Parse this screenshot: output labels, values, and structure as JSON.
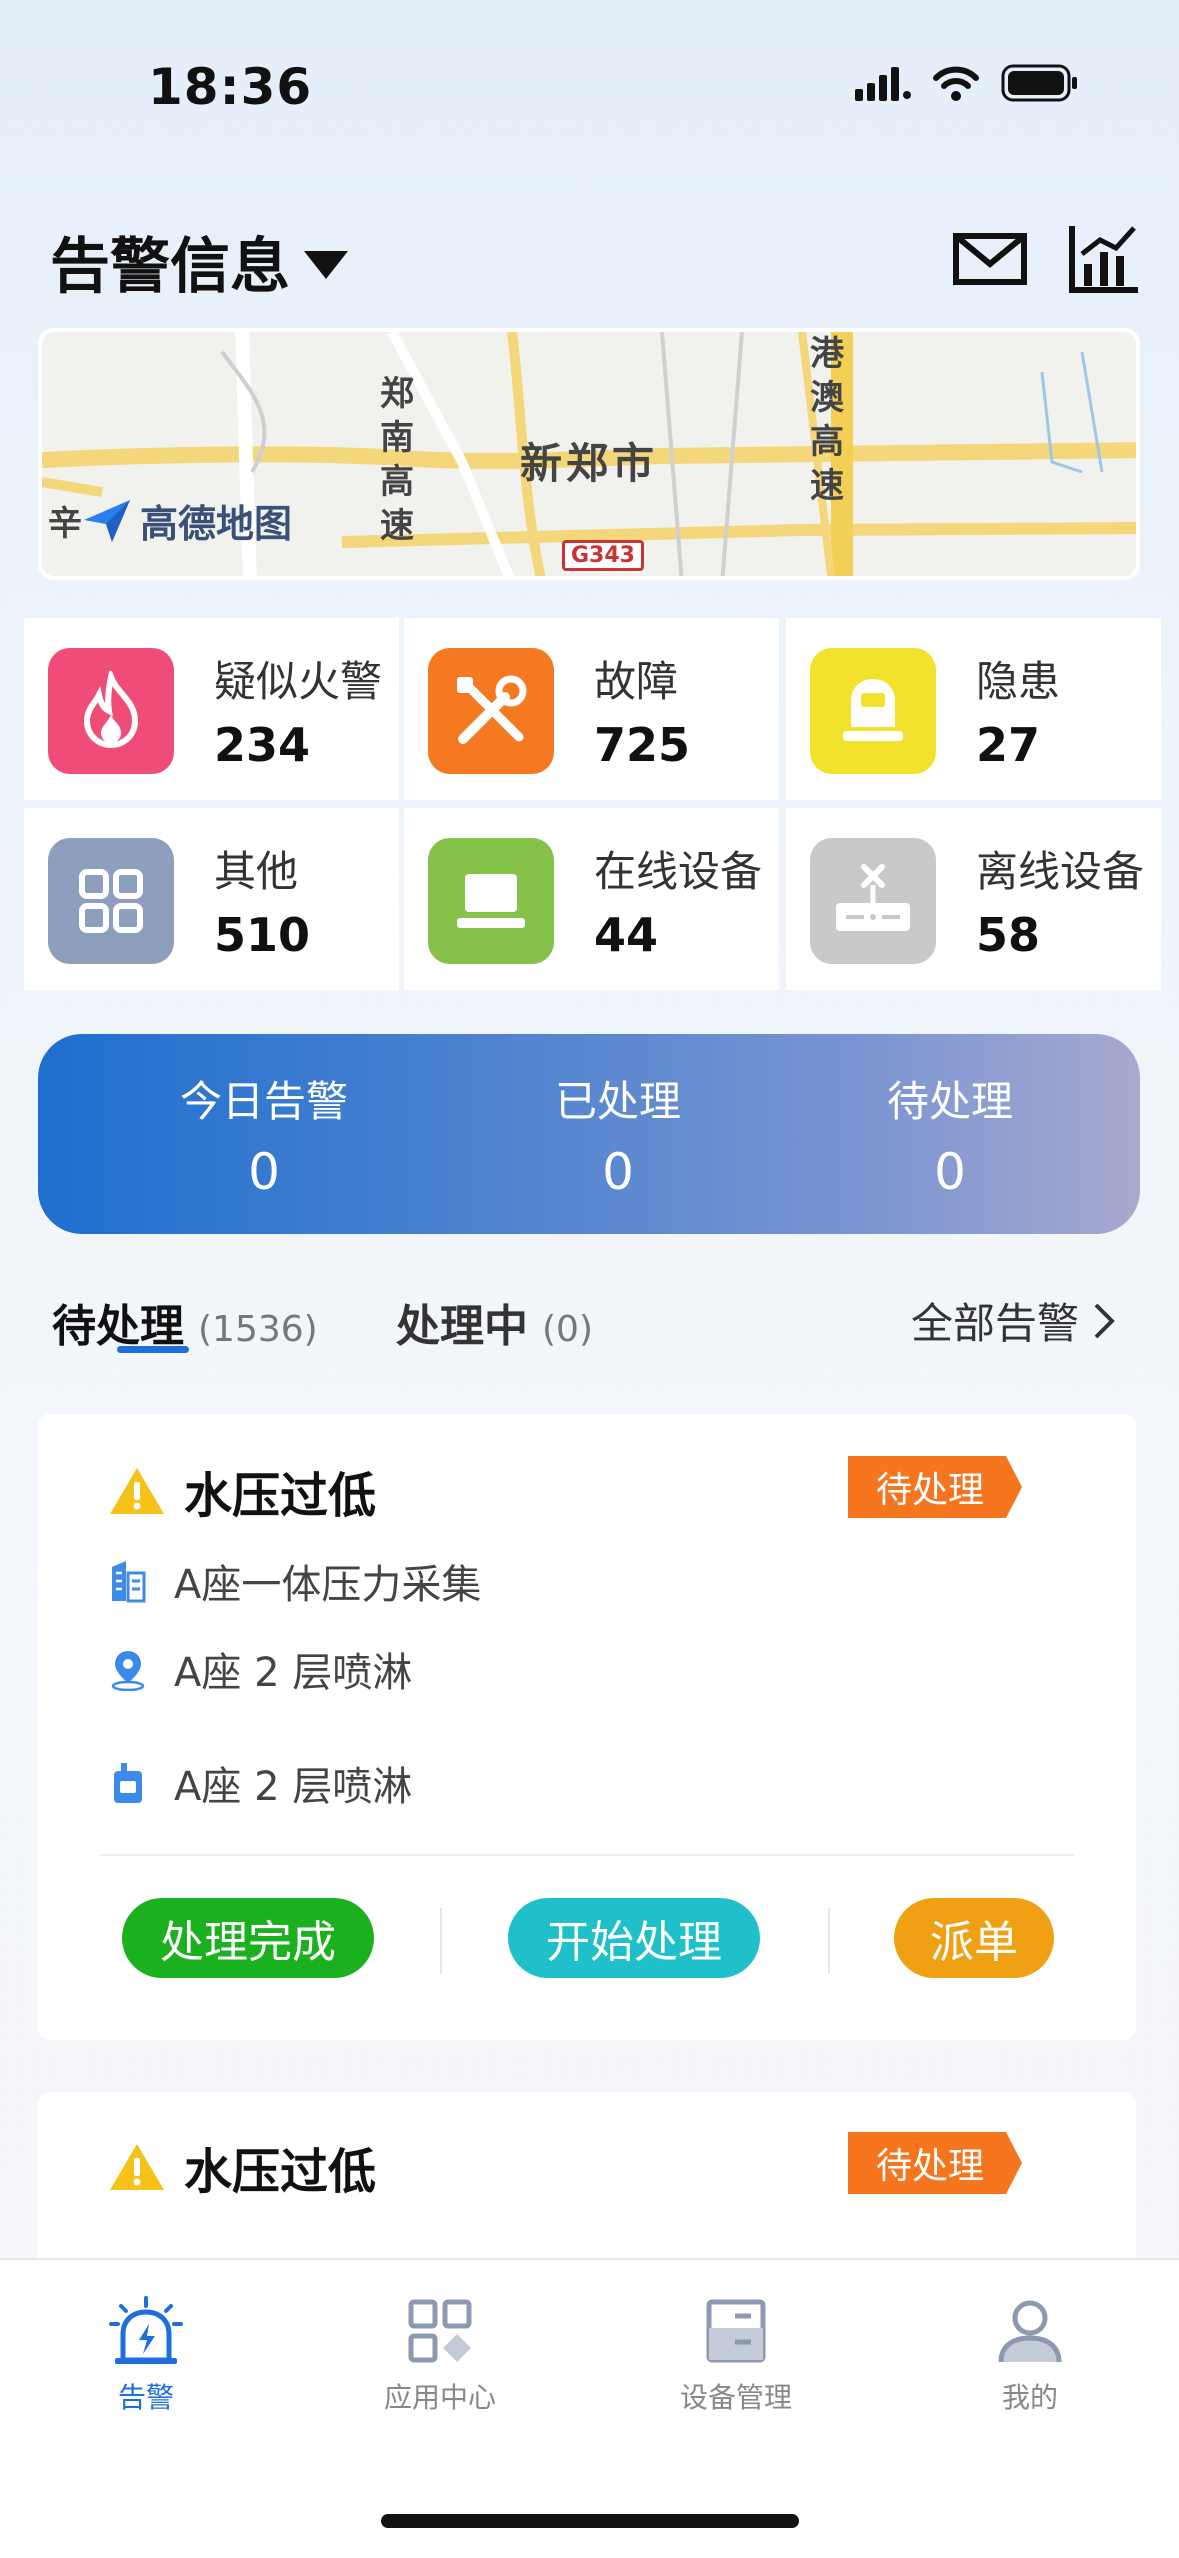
{
  "status_bar": {
    "time": "18:36"
  },
  "header": {
    "title": "告警信息",
    "mail_icon": "mail-icon",
    "chart_icon": "chart-icon"
  },
  "map": {
    "city": "新郑市",
    "road_left": "郑南高速",
    "road_right": "港澳高速",
    "road_tag": "G343",
    "logo": "高德地图",
    "partial_label": "辛"
  },
  "stats": [
    {
      "label": "疑似火警",
      "value": "234",
      "icon": "flame-icon",
      "color": "#ef4d78"
    },
    {
      "label": "故障",
      "value": "725",
      "icon": "tools-icon",
      "color": "#f47920"
    },
    {
      "label": "隐患",
      "value": "27",
      "icon": "hazard-icon",
      "color": "#f2e22c"
    },
    {
      "label": "其他",
      "value": "510",
      "icon": "grid-icon",
      "color": "#8e9fbd"
    },
    {
      "label": "在线设备",
      "value": "44",
      "icon": "laptop-icon",
      "color": "#86c24a"
    },
    {
      "label": "离线设备",
      "value": "58",
      "icon": "offline-device-icon",
      "color": "#c9c9c9"
    }
  ],
  "summary": {
    "today_label": "今日告警",
    "today_value": "0",
    "handled_label": "已处理",
    "handled_value": "0",
    "pending_label": "待处理",
    "pending_value": "0"
  },
  "tabs": [
    {
      "label": "待处理",
      "count": "(1536)",
      "active": true
    },
    {
      "label": "处理中",
      "count": "(0)",
      "active": false
    }
  ],
  "all_alerts_label": "全部告警",
  "alerts": [
    {
      "title": "水压过低",
      "status": "待处理",
      "device": "A座一体压力采集",
      "location": "A座 2 层喷淋",
      "system": "A座 2 层喷淋",
      "actions": {
        "complete": "处理完成",
        "start": "开始处理",
        "dispatch": "派单"
      }
    },
    {
      "title": "水压过低",
      "status": "待处理"
    }
  ],
  "colors": {
    "accent": "#1e6fdc",
    "status_tag": "#f6751f",
    "complete": "#1bb01e",
    "start": "#1fc0c9",
    "dispatch": "#f0a013"
  },
  "nav": [
    {
      "label": "告警",
      "icon": "alarm-icon",
      "active": true
    },
    {
      "label": "应用中心",
      "icon": "apps-icon",
      "active": false
    },
    {
      "label": "设备管理",
      "icon": "device-icon",
      "active": false
    },
    {
      "label": "我的",
      "icon": "profile-icon",
      "active": false
    }
  ]
}
